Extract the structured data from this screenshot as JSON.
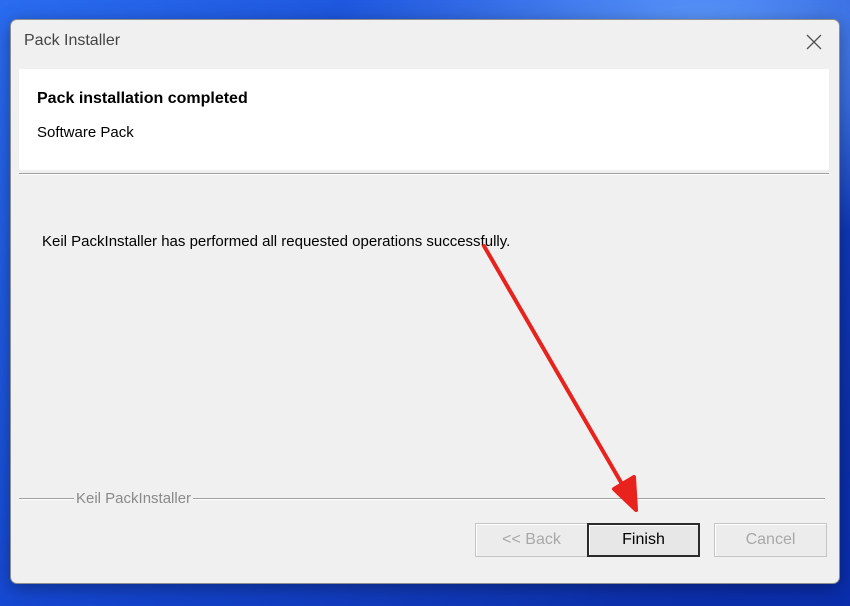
{
  "window": {
    "title": "Pack Installer"
  },
  "header": {
    "title": "Pack installation completed",
    "subtitle": "Software Pack"
  },
  "body": {
    "message": "Keil PackInstaller has performed all requested operations successfully."
  },
  "footer": {
    "group_label": "Keil PackInstaller",
    "back_label": "<< Back",
    "finish_label": "Finish",
    "cancel_label": "Cancel"
  },
  "colors": {
    "dialog_bg": "#f0f0f0",
    "header_bg": "#ffffff",
    "annotation_arrow": "#e8221d",
    "wallpaper": "#1a4fd6"
  },
  "icons": {
    "close": "close-icon",
    "annotation": "red-arrow-annotation"
  }
}
